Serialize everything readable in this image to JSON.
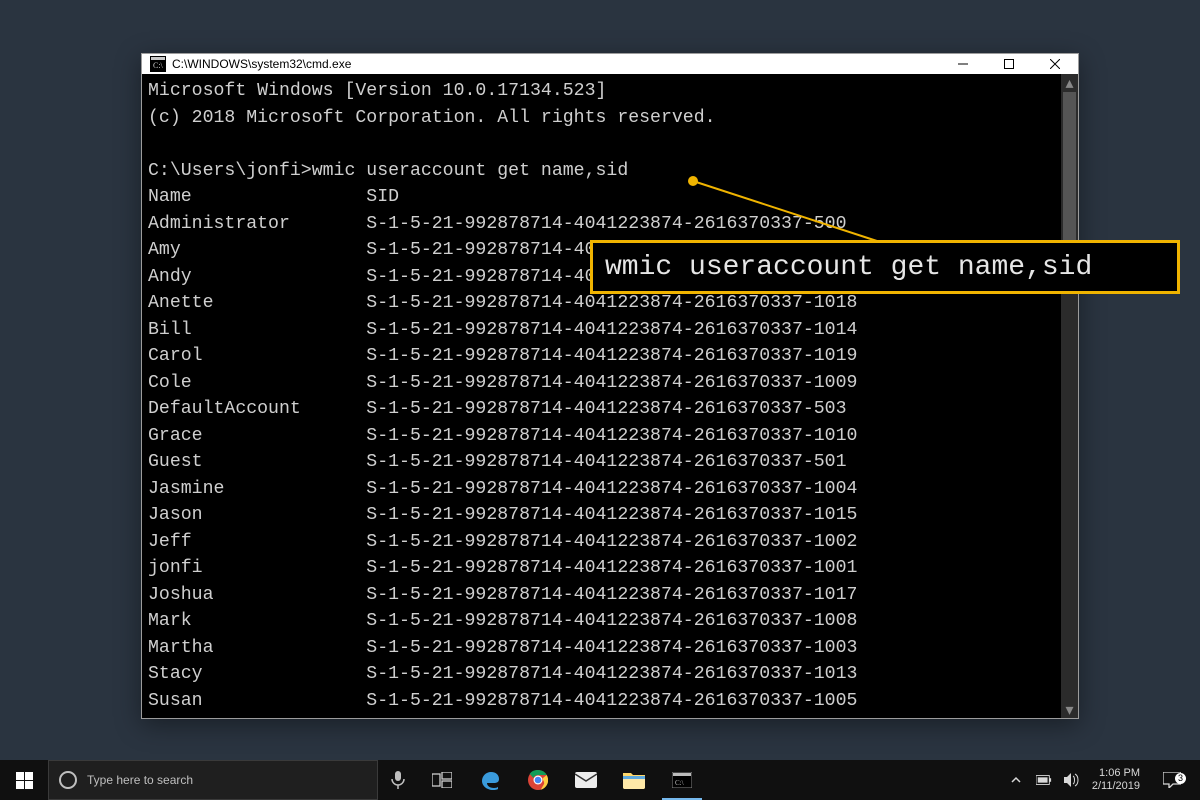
{
  "window": {
    "title": "C:\\WINDOWS\\system32\\cmd.exe"
  },
  "terminal": {
    "banner_line1": "Microsoft Windows [Version 10.0.17134.523]",
    "banner_line2": "(c) 2018 Microsoft Corporation. All rights reserved.",
    "prompt_prefix": "C:\\Users\\jonfi>",
    "command": "wmic useraccount get name,sid",
    "columns": {
      "name": "Name",
      "sid": "SID"
    },
    "rows": [
      {
        "name": "Administrator",
        "sid": "S-1-5-21-992878714-4041223874-2616370337-500"
      },
      {
        "name": "Amy",
        "sid": "S-1-5-21-992878714-4041223874-2616370337-1016"
      },
      {
        "name": "Andy",
        "sid": "S-1-5-21-992878714-4041223874-2616370337-1012"
      },
      {
        "name": "Anette",
        "sid": "S-1-5-21-992878714-4041223874-2616370337-1018"
      },
      {
        "name": "Bill",
        "sid": "S-1-5-21-992878714-4041223874-2616370337-1014"
      },
      {
        "name": "Carol",
        "sid": "S-1-5-21-992878714-4041223874-2616370337-1019"
      },
      {
        "name": "Cole",
        "sid": "S-1-5-21-992878714-4041223874-2616370337-1009"
      },
      {
        "name": "DefaultAccount",
        "sid": "S-1-5-21-992878714-4041223874-2616370337-503"
      },
      {
        "name": "Grace",
        "sid": "S-1-5-21-992878714-4041223874-2616370337-1010"
      },
      {
        "name": "Guest",
        "sid": "S-1-5-21-992878714-4041223874-2616370337-501"
      },
      {
        "name": "Jasmine",
        "sid": "S-1-5-21-992878714-4041223874-2616370337-1004"
      },
      {
        "name": "Jason",
        "sid": "S-1-5-21-992878714-4041223874-2616370337-1015"
      },
      {
        "name": "Jeff",
        "sid": "S-1-5-21-992878714-4041223874-2616370337-1002"
      },
      {
        "name": "jonfi",
        "sid": "S-1-5-21-992878714-4041223874-2616370337-1001"
      },
      {
        "name": "Joshua",
        "sid": "S-1-5-21-992878714-4041223874-2616370337-1017"
      },
      {
        "name": "Mark",
        "sid": "S-1-5-21-992878714-4041223874-2616370337-1008"
      },
      {
        "name": "Martha",
        "sid": "S-1-5-21-992878714-4041223874-2616370337-1003"
      },
      {
        "name": "Stacy",
        "sid": "S-1-5-21-992878714-4041223874-2616370337-1013"
      },
      {
        "name": "Susan",
        "sid": "S-1-5-21-992878714-4041223874-2616370337-1005"
      }
    ]
  },
  "callout": {
    "text": "wmic useraccount get name,sid"
  },
  "taskbar": {
    "search_placeholder": "Type here to search",
    "clock_time": "1:06 PM",
    "clock_date": "2/11/2019",
    "notification_count": "3"
  }
}
